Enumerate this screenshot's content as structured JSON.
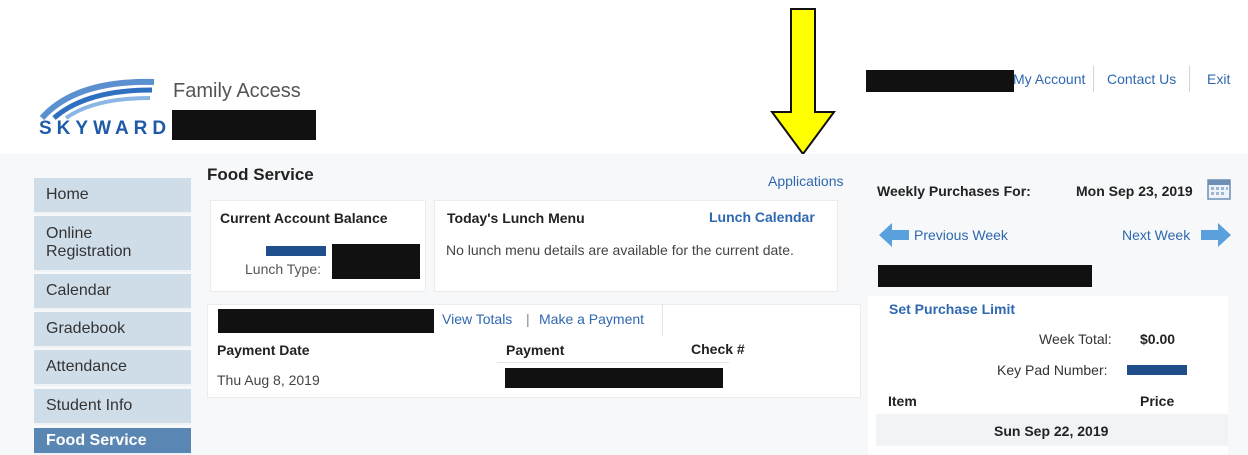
{
  "header": {
    "logo_text": "SKYWARD",
    "app_title": "Family Access",
    "links": [
      "My Account",
      "Contact Us",
      "Exit"
    ]
  },
  "nav": {
    "items": [
      {
        "label": "Home"
      },
      {
        "label": "Online\nRegistration"
      },
      {
        "label": "Calendar"
      },
      {
        "label": "Gradebook"
      },
      {
        "label": "Attendance"
      },
      {
        "label": "Student Info"
      },
      {
        "label": "Food Service"
      }
    ],
    "active": "Food Service"
  },
  "main": {
    "title": "Food Service",
    "applications_link": "Applications",
    "balance": {
      "heading": "Current Account Balance",
      "lunch_type_label": "Lunch Type:"
    },
    "lunch_menu": {
      "heading": "Today's Lunch Menu",
      "calendar_link": "Lunch Calendar",
      "message": "No lunch menu details are available for the current date."
    },
    "payments": {
      "view_totals": "View Totals",
      "separator": "|",
      "make_payment": "Make a Payment",
      "columns": [
        "Payment Date",
        "Payment",
        "Check #"
      ],
      "rows": [
        {
          "date": "Thu Aug 8, 2019"
        }
      ]
    }
  },
  "weekly": {
    "label": "Weekly Purchases For:",
    "date": "Mon Sep 23, 2019",
    "prev": "Previous Week",
    "next": "Next Week",
    "set_limit": "Set Purchase Limit",
    "week_total_label": "Week Total:",
    "week_total_value": "$0.00",
    "keypad_label": "Key Pad Number:",
    "columns": [
      "Item",
      "Price"
    ],
    "day_header": "Sun Sep 22, 2019"
  },
  "colors": {
    "link": "#2f68b0",
    "nav_bg": "#cfdde9",
    "nav_active": "#5a86b3",
    "arrow": "#ffff00"
  }
}
